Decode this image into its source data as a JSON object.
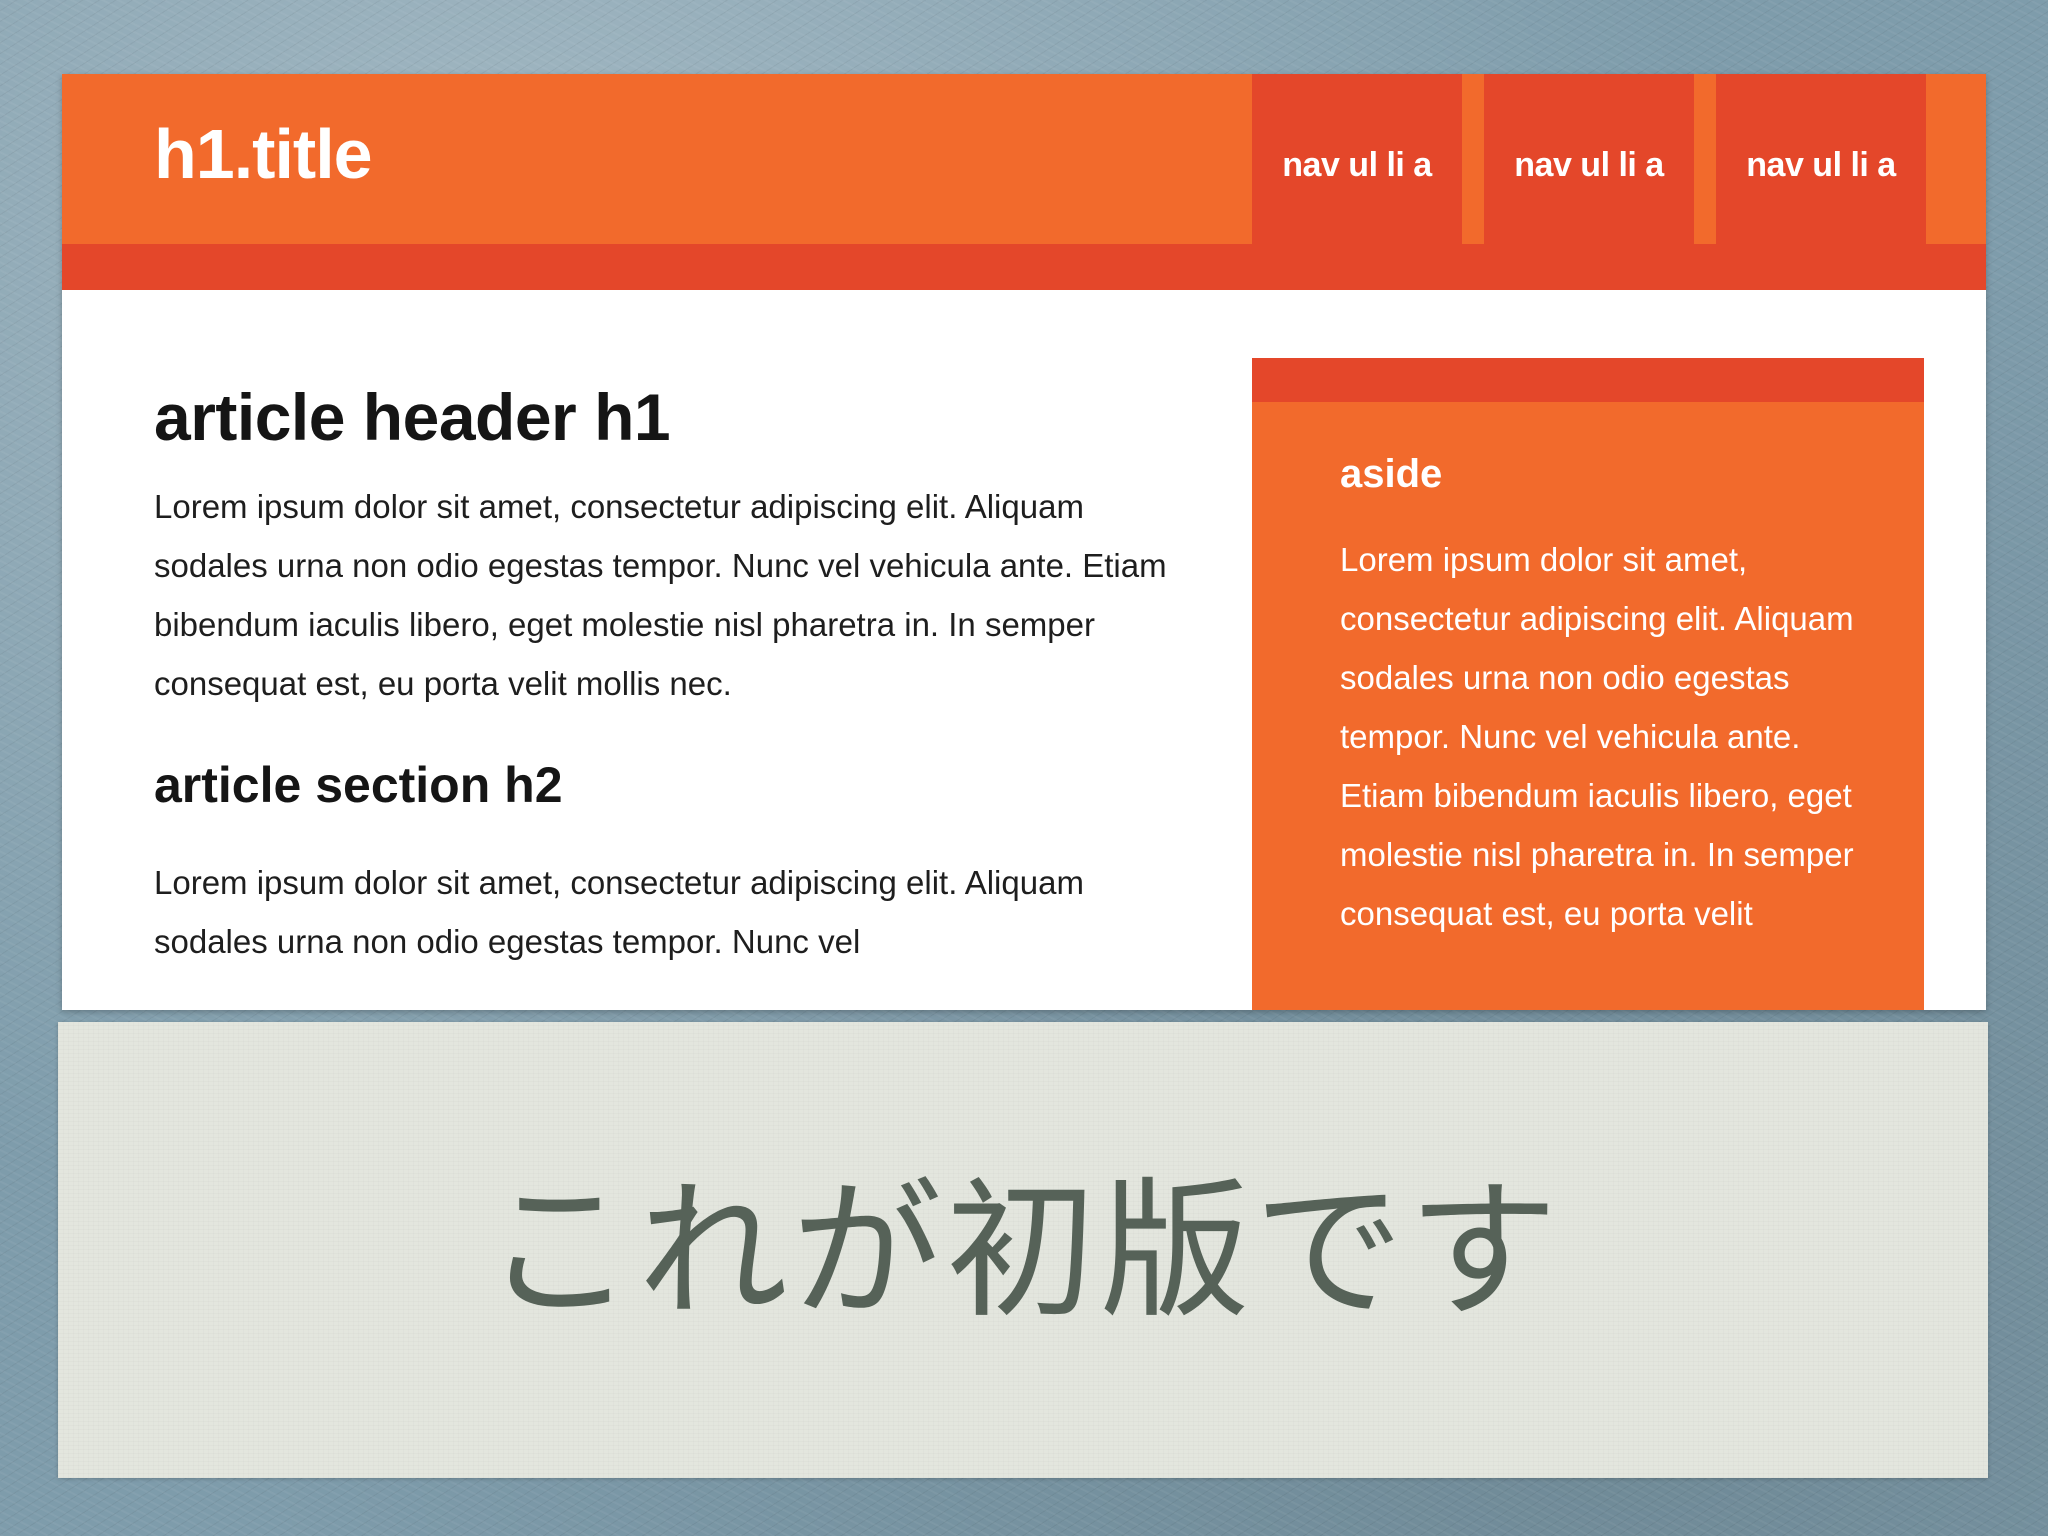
{
  "site": {
    "title": "h1.title",
    "nav": [
      "nav ul li a",
      "nav ul li a",
      "nav ul li a"
    ]
  },
  "article": {
    "heading": "article header h1",
    "paragraph1": "Lorem ipsum dolor sit amet, consectetur adipiscing elit. Aliquam sodales urna non odio egestas tempor. Nunc vel vehicula ante. Etiam bibendum iaculis libero, eget molestie nisl pharetra in. In semper consequat est, eu porta velit mollis nec.",
    "section_heading": "article section h2",
    "paragraph2": "Lorem ipsum dolor sit amet, consectetur adipiscing elit. Aliquam sodales urna non odio egestas tempor. Nunc vel"
  },
  "aside": {
    "title": "aside",
    "text": "Lorem ipsum dolor sit amet, consectetur adipiscing elit. Aliquam sodales urna non odio egestas tempor. Nunc vel vehicula ante. Etiam bibendum iaculis libero, eget molestie nisl pharetra in. In semper consequat est, eu porta velit"
  },
  "caption": {
    "text": "これが初版です"
  },
  "colors": {
    "accent_orange": "#f26a2c",
    "accent_red": "#e4472a",
    "background_blue": "#7e9cab",
    "caption_panel": "#e3e6de",
    "caption_text": "#566258"
  }
}
